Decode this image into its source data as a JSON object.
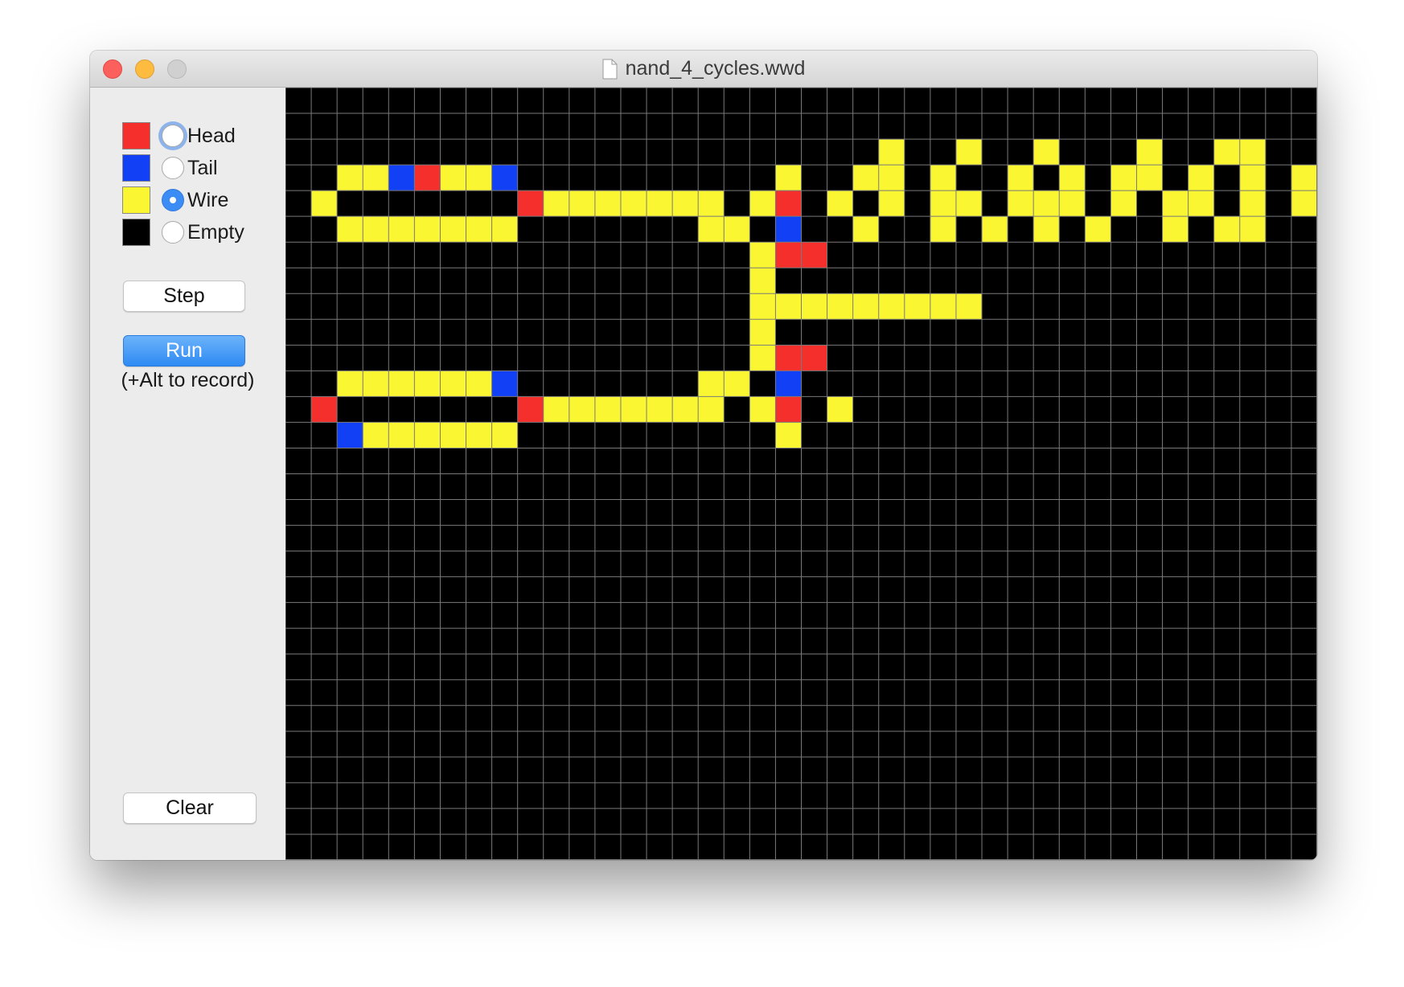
{
  "window": {
    "title": "nand_4_cycles.wwd"
  },
  "toolbar": {
    "legend": [
      {
        "label": "Head",
        "color": "#f5302c",
        "selected": false,
        "focused": true
      },
      {
        "label": "Tail",
        "color": "#1240f5",
        "selected": false,
        "focused": false
      },
      {
        "label": "Wire",
        "color": "#fbf632",
        "selected": true,
        "focused": false
      },
      {
        "label": "Empty",
        "color": "#000000",
        "selected": false,
        "focused": false
      }
    ],
    "step_label": "Step",
    "run_label": "Run",
    "run_hint": "(+Alt to record)",
    "clear_label": "Clear"
  },
  "grid": {
    "columns": 40,
    "rows": 30,
    "line_color": "#7a7a7a",
    "colors": {
      "W": "#fbf632",
      "H": "#f5302c",
      "T": "#1240f5"
    },
    "cells": [
      "........................................",
      "........................................",
      ".......................................,",
      "........................................",
      "........................................",
      "........................................",
      "........................................",
      "........................................",
      "........................................",
      "........................................",
      "........................................",
      "........................................",
      "........................................",
      "........................................",
      "........................................",
      "........................................",
      "........................................",
      "........................................",
      "........................................",
      "........................................",
      "........................................",
      "........................................",
      "........................................",
      "........................................",
      "........................................",
      "........................................",
      "........................................",
      "........................................",
      "........................................",
      "........................................"
    ],
    "rows_data": [
      "........................................",
      "........................................",
      ".......................W..W..W...W..WW..",
      "..WWTHWWT..........W..WW.W..W.W.WW.W.W.W",
      ".W.......HWWWWWWW.WH.W.W.WW.WWW.W.WW.W.W",
      "..WWWWWWW.......WW.T..W..W.W.W.W..W.WW..",
      "..................WHH...................",
      "..................W.....................",
      "..................WWWWWWWWW.............",
      "..................W.....................",
      "..................WHH...................",
      "..WWWWWWT.......WW.T....................",
      ".H.......HWWWWWWW.WH.W..................",
      "..TWWWWWW..........W....................",
      "........................................",
      "........................................",
      "........................................",
      "........................................",
      "........................................",
      "........................................",
      "........................................",
      "........................................",
      "........................................",
      "........................................",
      "........................................",
      "........................................",
      "........................................",
      "........................................",
      "........................................",
      "........................................"
    ]
  }
}
